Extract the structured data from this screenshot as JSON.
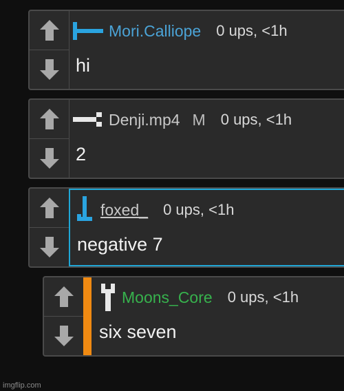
{
  "comments": [
    {
      "username": "Mori.Calliope",
      "badge": "",
      "meta": "0 ups, <1h",
      "text": "hi",
      "name_color": "#4ba3d6",
      "icon": "rank-bracket-icon"
    },
    {
      "username": "Denji.mp4",
      "badge": "M",
      "meta": "0 ups, <1h",
      "text": "2",
      "name_color": "#c8c8c8",
      "icon": "rank-bar-icon"
    },
    {
      "username": "foxed_",
      "badge": "",
      "meta": "0 ups, <1h",
      "text": "negative 7",
      "name_color": "#c8c8c8",
      "highlight_border": "#1fa7d6",
      "icon": "rank-flag-icon"
    },
    {
      "username": "Moons_Core",
      "badge": "",
      "meta": "0 ups, <1h",
      "text": "six seven",
      "name_color": "#37b24d",
      "rank_color": "#f08a12",
      "icon": "rank-pillar-icon"
    }
  ],
  "watermark": "imgflip.com",
  "icons": {
    "upvote": "arrow-up-icon",
    "downvote": "arrow-down-icon"
  }
}
